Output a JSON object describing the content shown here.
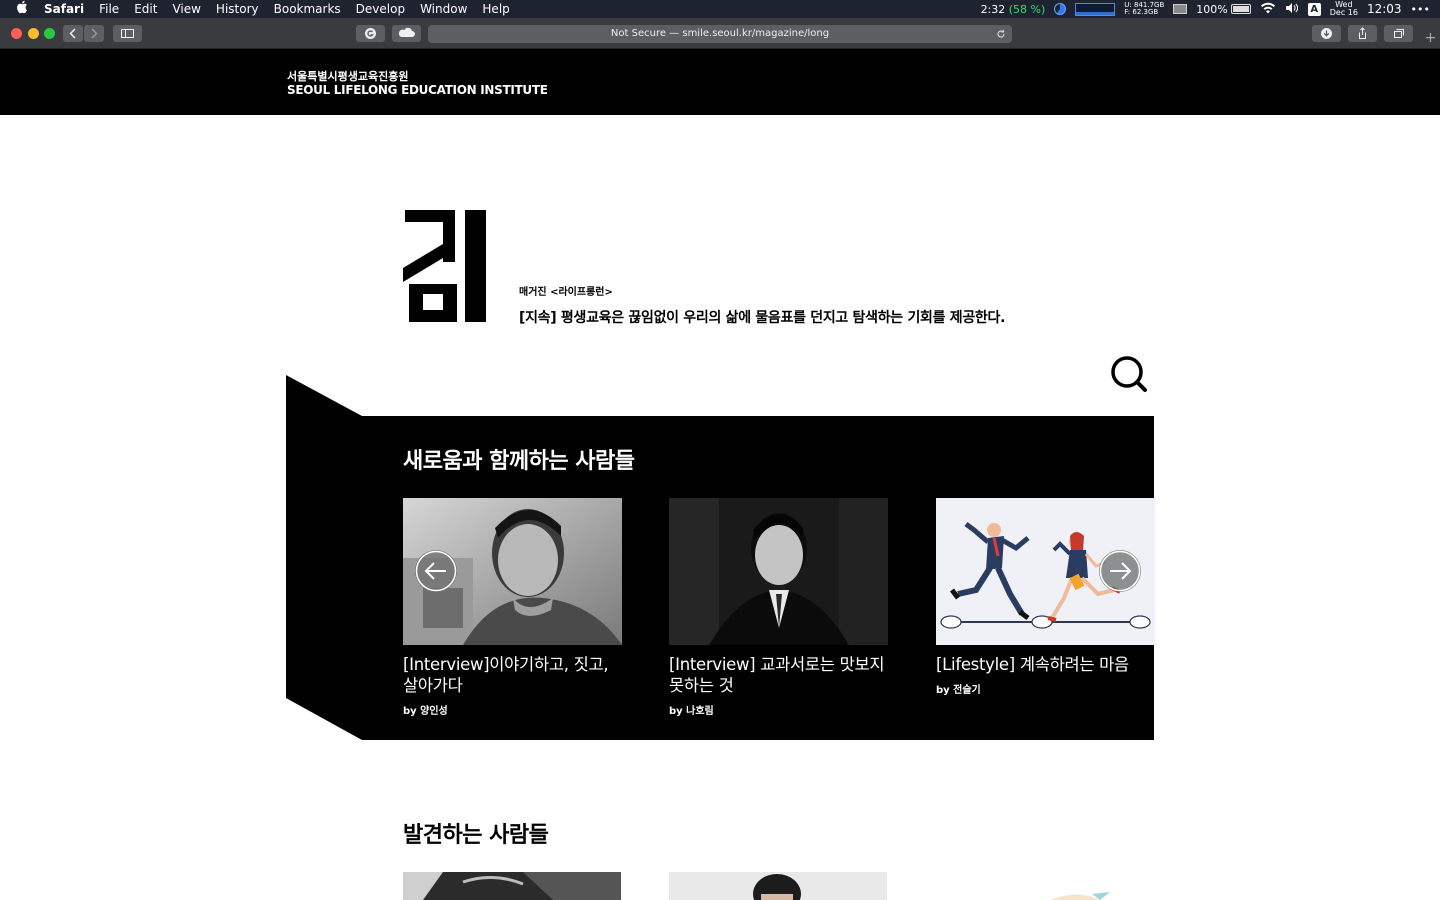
{
  "menubar": {
    "app": "Safari",
    "items": [
      "File",
      "Edit",
      "View",
      "History",
      "Bookmarks",
      "Develop",
      "Window",
      "Help"
    ],
    "battery_time": "2:32",
    "battery_pct_paren": "(58 %)",
    "disk_used": "U: 841.7GB",
    "disk_free": "F:  62.3GB",
    "battery_level": "100%",
    "input_lang": "A",
    "day": "Wed",
    "date": "Dec 16",
    "time": "12:03",
    "more": "•••"
  },
  "browser": {
    "address": "Not Secure — smile.seoul.kr/magazine/long",
    "new_tab": "+"
  },
  "site": {
    "org_ko": "서울특별시평생교육진흥원",
    "org_en": "SEOUL LIFELONG EDUCATION INSTITUTE"
  },
  "magazine": {
    "label": "매거진 <라이프롱런>",
    "description": "[지속] 평생교육은 끊임없이 우리의 삶에 물음표를 던지고 탐색하는 기회를 제공한다."
  },
  "feature": {
    "title": "새로움과 함께하는 사람들",
    "cards": [
      {
        "title": "[Interview]이야기하고, 짓고, 살아가다",
        "byline": "by 양인성"
      },
      {
        "title": "[Interview] 교과서로는 맛보지 못하는 것",
        "byline": "by 나호림"
      },
      {
        "title": "[Lifestyle] 계속하려는 마음",
        "byline": "by 전슬기"
      }
    ]
  },
  "section2": {
    "title": "발견하는 사람들"
  },
  "colors": {
    "accent_black": "#000000",
    "menubar_bg": "#1d2430",
    "toolbar_bg": "#393b3e"
  }
}
